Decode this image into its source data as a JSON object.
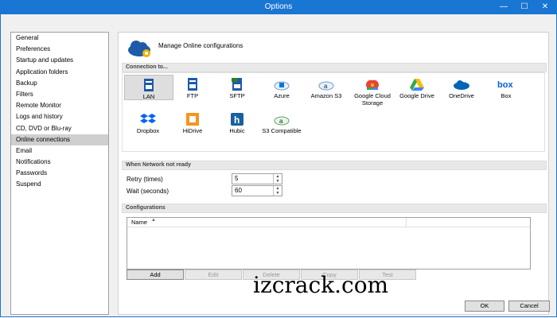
{
  "window": {
    "title": "Options",
    "minimize": "—",
    "maximize": "☐",
    "close": "✕"
  },
  "sidebar": {
    "items": [
      {
        "label": "General"
      },
      {
        "label": "Preferences"
      },
      {
        "label": "Startup and updates"
      },
      {
        "label": "Application folders"
      },
      {
        "label": "Backup"
      },
      {
        "label": "Filters"
      },
      {
        "label": "Remote Monitor"
      },
      {
        "label": "Logs and history"
      },
      {
        "label": "CD, DVD or Blu-ray"
      },
      {
        "label": "Online connections",
        "selected": true
      },
      {
        "label": "Email"
      },
      {
        "label": "Notifications"
      },
      {
        "label": "Passwords"
      },
      {
        "label": "Suspend"
      }
    ]
  },
  "main": {
    "header": "Manage Online configurations",
    "connection_section": "Connection to...",
    "connections": [
      {
        "label": "LAN",
        "icon": "lan-icon",
        "selected": true
      },
      {
        "label": "FTP",
        "icon": "ftp-icon"
      },
      {
        "label": "SFTP",
        "icon": "sftp-icon"
      },
      {
        "label": "Azure",
        "icon": "azure-icon"
      },
      {
        "label": "Amazon S3",
        "icon": "amazon-s3-icon"
      },
      {
        "label": "Google Cloud Storage",
        "icon": "google-cloud-icon"
      },
      {
        "label": "Google Drive",
        "icon": "google-drive-icon"
      },
      {
        "label": "OneDrive",
        "icon": "onedrive-icon"
      },
      {
        "label": "Box",
        "icon": "box-icon"
      },
      {
        "label": "Dropbox",
        "icon": "dropbox-icon"
      },
      {
        "label": "HiDrive",
        "icon": "hidrive-icon"
      },
      {
        "label": "Hubic",
        "icon": "hubic-icon"
      },
      {
        "label": "S3 Compatible",
        "icon": "s3-compatible-icon"
      }
    ],
    "network_section": "When Network not ready",
    "retry": {
      "label": "Retry (times)",
      "value": "5"
    },
    "wait": {
      "label": "Wait (seconds)",
      "value": "60"
    },
    "configurations_section": "Configurations",
    "list_column": "Name",
    "buttons": {
      "add": "Add",
      "edit": "Edit",
      "delete": "Delete",
      "copy": "Copy",
      "test": "Test"
    }
  },
  "watermark": "izcrack.com",
  "dialog": {
    "ok": "OK",
    "cancel": "Cancel"
  },
  "colors": {
    "titlebar": "#1976d2",
    "selected": "#cfcfcf"
  }
}
